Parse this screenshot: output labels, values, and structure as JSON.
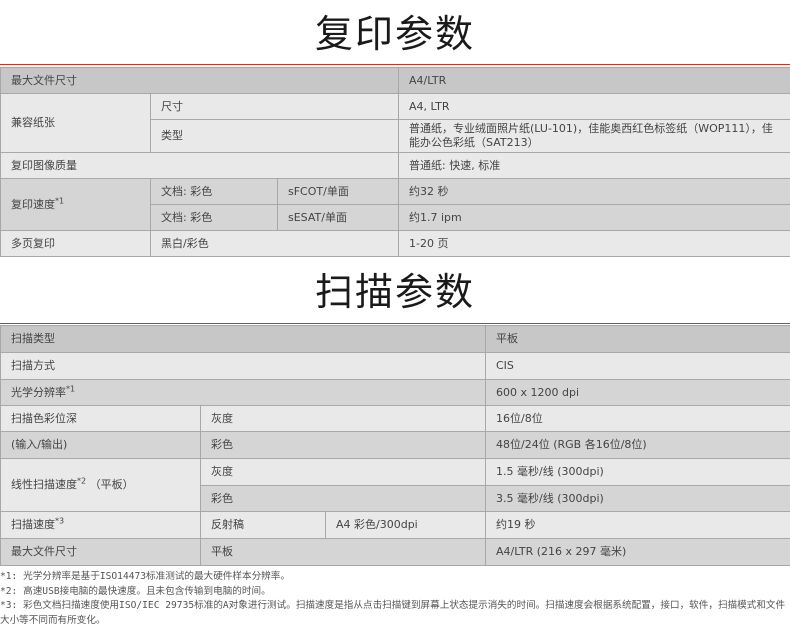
{
  "copy": {
    "title": "复印参数",
    "max_size_label": "最大文件尺寸",
    "max_size_value": "A4/LTR",
    "media_label": "兼容纸张",
    "media_size_label": "尺寸",
    "media_size_value": "A4, LTR",
    "media_type_label": "类型",
    "media_type_value": "普通纸，专业绒面照片纸(LU-101)，佳能奥西红色标签纸（WOP111），佳能办公色彩纸（SAT213）",
    "quality_label": "复印图像质量",
    "quality_value": "普通纸: 快速, 标准",
    "speed_label": "复印速度",
    "speed_sup": "*1",
    "speed_row1_doc": "文档: 彩色",
    "speed_row1_mode": "sFCOT/单面",
    "speed_row1_value": "约32 秒",
    "speed_row2_doc": "文档: 彩色",
    "speed_row2_mode": "sESAT/单面",
    "speed_row2_value": "约1.7 ipm",
    "multi_label": "多页复印",
    "multi_mode": "黑白/彩色",
    "multi_value": "1-20 页"
  },
  "scan": {
    "title": "扫描参数",
    "type_label": "扫描类型",
    "type_value": "平板",
    "method_label": "扫描方式",
    "method_value": "CIS",
    "res_label": "光学分辨率",
    "res_sup": "*1",
    "res_value": "600 x 1200 dpi",
    "depth_label": "扫描色彩位深",
    "depth_gray_label": "灰度",
    "depth_gray_value": "16位/8位",
    "io_label": "(输入/输出)",
    "depth_color_label": "彩色",
    "depth_color_value": "48位/24位 (RGB 各16位/8位)",
    "line_label": "线性扫描速度",
    "line_sup": "*2",
    "line_suffix": "（平板）",
    "line_gray_label": "灰度",
    "line_gray_value": "1.5 毫秒/线 (300dpi)",
    "line_color_label": "彩色",
    "line_color_value": "3.5 毫秒/线 (300dpi)",
    "speed_label": "扫描速度",
    "speed_sup": "*3",
    "speed_source": "反射稿",
    "speed_mode": "A4 彩色/300dpi",
    "speed_value": "约19 秒",
    "max_label": "最大文件尺寸",
    "max_source": "平板",
    "max_value": "A4/LTR (216 x 297 毫米)"
  },
  "footnotes": {
    "n1": "*1: 光学分辨率是基于ISO14473标准测试的最大硬件样本分辨率。",
    "n2": "*2: 高速USB接电脑的最快速度。且未包含传输到电脑的时间。",
    "n3": "*3: 彩色文档扫描速度使用ISO/IEC 29735标准的A对象进行测试。扫描速度是指从点击扫描键到屏幕上状态提示消失的时间。扫描速度会根据系统配置，接口，软件，扫描模式和文件大小等不同而有所变化。"
  },
  "colors": {
    "accent_line": "#c0392b",
    "row_light": "#e9e9e9",
    "row_dark": "#d5d5d5",
    "row_mid": "#c7c7c7"
  }
}
